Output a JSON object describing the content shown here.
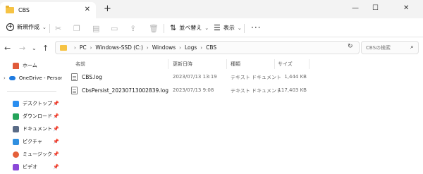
{
  "tab": {
    "title": "CBS",
    "close": "✕",
    "new_tab": "+"
  },
  "window_controls": {
    "minimize": "—",
    "maximize": "☐",
    "close": "✕"
  },
  "command_bar": {
    "new_label": "新規作成",
    "sort_label": "並べ替え",
    "view_label": "表示",
    "more": "···"
  },
  "address_bar": {
    "crumbs": [
      "PC",
      "Windows-SSD (C:)",
      "Windows",
      "Logs",
      "CBS"
    ]
  },
  "search": {
    "placeholder": "CBSの検索"
  },
  "sidebar": {
    "home": "ホーム",
    "onedrive": "OneDrive - Persona",
    "items": [
      {
        "label": "デスクトップ",
        "color": "#2a8ef0"
      },
      {
        "label": "ダウンロード",
        "color": "#25a45a"
      },
      {
        "label": "ドキュメント",
        "color": "#5a6b86"
      },
      {
        "label": "ピクチャ",
        "color": "#2f8fe0"
      },
      {
        "label": "ミュージック",
        "color": "#e4603a"
      },
      {
        "label": "ビデオ",
        "color": "#8a48d8"
      }
    ]
  },
  "columns": {
    "name": "名前",
    "date": "更新日時",
    "type": "種類",
    "size": "サイズ"
  },
  "files": [
    {
      "name": "CBS.log",
      "date": "2023/07/13 13:19",
      "type": "テキスト ドキュメント",
      "size": "1,444 KB"
    },
    {
      "name": "CbsPersist_20230713002839.log",
      "date": "2023/07/13 9:08",
      "type": "テキスト ドキュメント",
      "size": "117,403 KB"
    }
  ]
}
